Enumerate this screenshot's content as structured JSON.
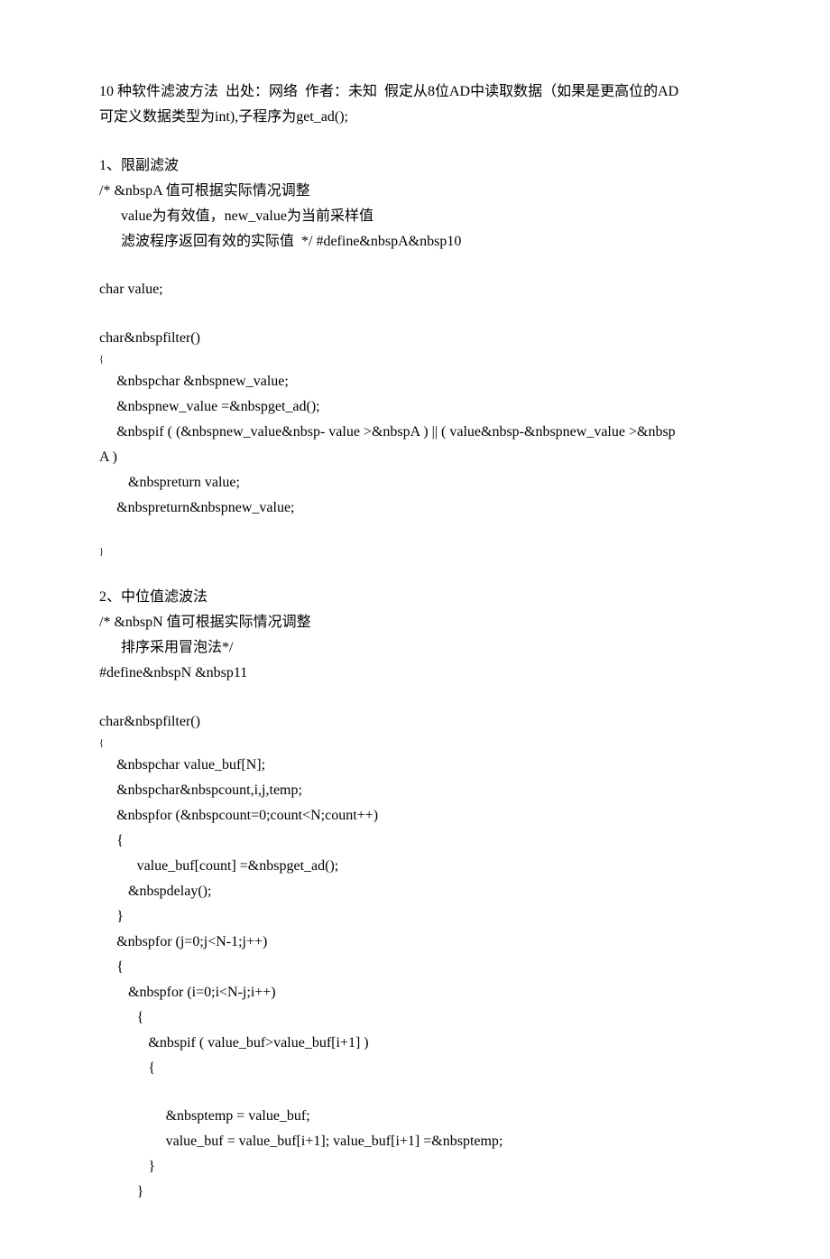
{
  "head": {
    "l1": "10 种软件滤波方法  出处：网络  作者：未知  假定从8位AD中读取数据（如果是更高位的AD",
    "l2": "可定义数据类型为int),子程序为get_ad();"
  },
  "sec1": {
    "title": "1、限副滤波",
    "c1": "/* &nbspA 值可根据实际情况调整",
    "c2": "value为有效值，new_value为当前采样值",
    "c3": "滤波程序返回有效的实际值  */ #define&nbspA&nbsp10",
    "d1": "char value;",
    "d2": "char&nbspfilter()",
    "lb": "{",
    "b1": "&nbspchar &nbspnew_value;",
    "b2": "&nbspnew_value =&nbspget_ad();",
    "b3": "&nbspif ( (&nbspnew_value&nbsp- value >&nbspA ) || ( value&nbsp-&nbspnew_value >&nbsp",
    "b3b": "A )",
    "b4": "&nbspreturn value;",
    "b5": "&nbspreturn&nbspnew_value;",
    "rb": "}"
  },
  "sec2": {
    "title": "2、中位值滤波法",
    "c1": "/* &nbspN 值可根据实际情况调整",
    "c2": "排序采用冒泡法*/",
    "d0": "#define&nbspN &nbsp11",
    "d1": "char&nbspfilter()",
    "lb": "{",
    "b1": "&nbspchar value_buf[N];",
    "b2": "&nbspchar&nbspcount,i,j,temp;",
    "b3": "&nbspfor (&nbspcount=0;count<N;count++)",
    "b4": "{",
    "b5": "value_buf[count] =&nbspget_ad();",
    "b6": "&nbspdelay();",
    "b7": "}",
    "b8": "&nbspfor (j=0;j<N-1;j++)",
    "b9": "{",
    "b10": "&nbspfor (i=0;i<N-j;i++)",
    "b11": "{",
    "b12": "&nbspif ( value_buf>value_buf[i+1] )",
    "b13": "{",
    "b14": "&nbsptemp = value_buf;",
    "b15": "value_buf = value_buf[i+1]; value_buf[i+1] =&nbsptemp;",
    "b16": "}",
    "b17": "}"
  }
}
